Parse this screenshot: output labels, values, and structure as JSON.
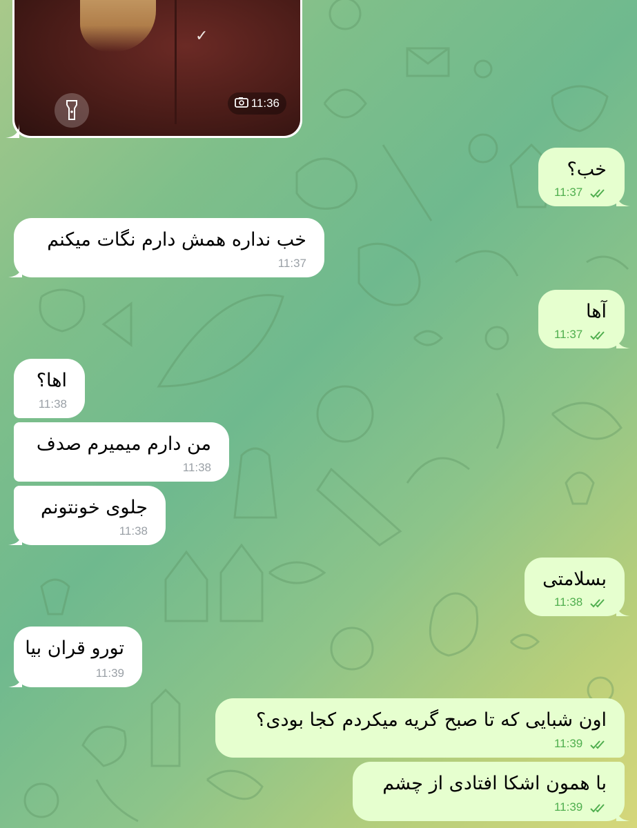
{
  "chat": {
    "media_message": {
      "time": "11:36",
      "icons": [
        "flashlight-icon",
        "camera-icon"
      ]
    },
    "messages": [
      {
        "id": "m1",
        "direction": "outgoing",
        "text": "خب؟",
        "time": "11:37",
        "status": "read"
      },
      {
        "id": "m2",
        "direction": "incoming",
        "text": "خب نداره همش دارم نگات میکنم",
        "time": "11:37"
      },
      {
        "id": "m3",
        "direction": "outgoing",
        "text": "آها",
        "time": "11:37",
        "status": "read"
      },
      {
        "id": "m4",
        "direction": "incoming",
        "text": "اها؟",
        "time": "11:38"
      },
      {
        "id": "m5",
        "direction": "incoming",
        "text": "من دارم میمیرم صدف",
        "time": "11:38"
      },
      {
        "id": "m6",
        "direction": "incoming",
        "text": "جلوی خونتونم",
        "time": "11:38"
      },
      {
        "id": "m7",
        "direction": "outgoing",
        "text": "بسلامتی",
        "time": "11:38",
        "status": "read"
      },
      {
        "id": "m8",
        "direction": "incoming",
        "text": "تورو قران بیا",
        "time": "11:39"
      },
      {
        "id": "m9",
        "direction": "outgoing",
        "text": "اون شبایی که تا صبح گریه میکردم کجا بودی؟",
        "time": "11:39",
        "status": "read"
      },
      {
        "id": "m10",
        "direction": "outgoing",
        "text": "با همون اشکا افتادی از چشم",
        "time": "11:39",
        "status": "read"
      }
    ]
  },
  "colors": {
    "incoming_bubble": "#ffffff",
    "outgoing_bubble": "#e6ffcf",
    "outgoing_meta": "#4fae4e",
    "incoming_meta": "#9aa0a6"
  }
}
